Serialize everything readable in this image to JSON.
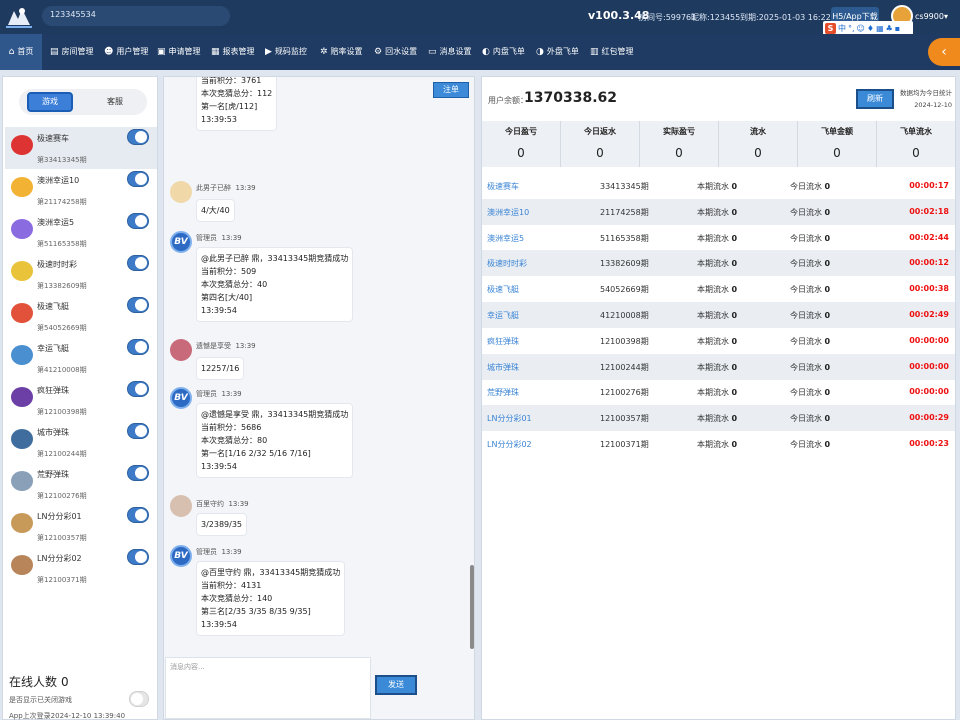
{
  "topbar": {
    "account": "123345534",
    "version": "v100.3.48",
    "room_no": "房间号:599761",
    "nickname": "昵称:123455",
    "expiry": "到期:2025-01-03 16:22:42",
    "h5_label": "H5/App下载",
    "username": "cs9900",
    "ime_label": "S"
  },
  "nav": [
    {
      "label": "首页",
      "icon": "home-icon"
    },
    {
      "label": "房间管理",
      "icon": "room-icon"
    },
    {
      "label": "用户管理",
      "icon": "users-icon"
    },
    {
      "label": "申请管理",
      "icon": "apply-icon"
    },
    {
      "label": "报表管理",
      "icon": "calendar-icon"
    },
    {
      "label": "规码监控",
      "icon": "monitor-icon"
    },
    {
      "label": "赔率设置",
      "icon": "gear-icon"
    },
    {
      "label": "回水设置",
      "icon": "settings-icon"
    },
    {
      "label": "消息设置",
      "icon": "message-icon"
    },
    {
      "label": "内盘飞单",
      "icon": "inner-icon"
    },
    {
      "label": "外盘飞单",
      "icon": "outer-icon"
    },
    {
      "label": "红包管理",
      "icon": "redpacket-icon"
    }
  ],
  "left": {
    "tab_active": "游戏",
    "tab_inactive": "客服",
    "rooms": [
      {
        "name": "极速赛车",
        "period": "第33413345期"
      },
      {
        "name": "澳洲幸运10",
        "period": "第21174258期"
      },
      {
        "name": "澳洲幸运5",
        "period": "第51165358期"
      },
      {
        "name": "极速时时彩",
        "period": "第13382609期"
      },
      {
        "name": "极速飞艇",
        "period": "第54052669期"
      },
      {
        "name": "幸运飞艇",
        "period": "第41210008期"
      },
      {
        "name": "疯狂弹珠",
        "period": "第12100398期"
      },
      {
        "name": "城市弹珠",
        "period": "第12100244期"
      },
      {
        "name": "荒野弹珠",
        "period": "第12100276期"
      },
      {
        "name": "LN分分彩01",
        "period": "第12100357期"
      },
      {
        "name": "LN分分彩02",
        "period": "第12100371期"
      }
    ],
    "online_label": "在线人数",
    "online_count": "0",
    "hide_label": "是否显示已关闭游戏",
    "last_login": "App上次登录2024-12-10 13:39:40"
  },
  "chat": {
    "register_btn": "注单",
    "messages": [
      {
        "lines": [
          "当前积分：3761",
          "本次竞猜总分：112",
          "第一名[虎/112]",
          "13:39:53"
        ]
      },
      {
        "name": "此男子已醉",
        "time": "13:39",
        "lines": [
          "4/大/40"
        ]
      },
      {
        "name": "管理员",
        "time": "13:39",
        "lines": [
          "@此男子已醉 鼎，33413345期竞猜成功",
          "当前积分：509",
          "本次竞猜总分：40",
          "第四名[大/40]",
          "13:39:54"
        ]
      },
      {
        "name": "遗憾是享受",
        "time": "13:39",
        "lines": [
          "12257/16"
        ]
      },
      {
        "name": "管理员",
        "time": "13:39",
        "lines": [
          "@遗憾是享受 鼎，33413345期竞猜成功",
          "当前积分：5686",
          "本次竞猜总分：80",
          "第一名[1/16 2/32 5/16 7/16]",
          "13:39:54"
        ]
      },
      {
        "name": "百里守约",
        "time": "13:39",
        "lines": [
          "3/2389/35"
        ]
      },
      {
        "name": "管理员",
        "time": "13:39",
        "lines": [
          "@百里守约 鼎，33413345期竞猜成功",
          "当前积分：4131",
          "本次竞猜总分：140",
          "第三名[2/35 3/35 8/35 9/35]",
          "13:39:54"
        ]
      }
    ],
    "input_placeholder": "消息内容...",
    "send_btn": "发送"
  },
  "right": {
    "balance_label": "用户余额：",
    "balance": "1370338.62",
    "refresh_btn": "刷新",
    "stat_note_1": "数据均为今日统计",
    "stat_note_2": "2024-12-10",
    "stats": [
      {
        "label": "今日盈亏",
        "value": "0"
      },
      {
        "label": "今日返水",
        "value": "0"
      },
      {
        "label": "实际盈亏",
        "value": "0"
      },
      {
        "label": "流水",
        "value": "0"
      },
      {
        "label": "飞单金额",
        "value": "0"
      },
      {
        "label": "飞单流水",
        "value": "0"
      }
    ],
    "rows": [
      {
        "name": "极速赛车",
        "period": "33413345期",
        "cur_label": "本期流水",
        "cur": "0",
        "day_label": "今日流水",
        "day": "0",
        "timer": "00:00:17"
      },
      {
        "name": "澳洲幸运10",
        "period": "21174258期",
        "cur_label": "本期流水",
        "cur": "0",
        "day_label": "今日流水",
        "day": "0",
        "timer": "00:02:18"
      },
      {
        "name": "澳洲幸运5",
        "period": "51165358期",
        "cur_label": "本期流水",
        "cur": "0",
        "day_label": "今日流水",
        "day": "0",
        "timer": "00:02:44"
      },
      {
        "name": "极速时时彩",
        "period": "13382609期",
        "cur_label": "本期流水",
        "cur": "0",
        "day_label": "今日流水",
        "day": "0",
        "timer": "00:00:12"
      },
      {
        "name": "极速飞艇",
        "period": "54052669期",
        "cur_label": "本期流水",
        "cur": "0",
        "day_label": "今日流水",
        "day": "0",
        "timer": "00:00:38"
      },
      {
        "name": "幸运飞艇",
        "period": "41210008期",
        "cur_label": "本期流水",
        "cur": "0",
        "day_label": "今日流水",
        "day": "0",
        "timer": "00:02:49"
      },
      {
        "name": "疯狂弹珠",
        "period": "12100398期",
        "cur_label": "本期流水",
        "cur": "0",
        "day_label": "今日流水",
        "day": "0",
        "timer": "00:00:00"
      },
      {
        "name": "城市弹珠",
        "period": "12100244期",
        "cur_label": "本期流水",
        "cur": "0",
        "day_label": "今日流水",
        "day": "0",
        "timer": "00:00:00"
      },
      {
        "name": "荒野弹珠",
        "period": "12100276期",
        "cur_label": "本期流水",
        "cur": "0",
        "day_label": "今日流水",
        "day": "0",
        "timer": "00:00:00"
      },
      {
        "name": "LN分分彩01",
        "period": "12100357期",
        "cur_label": "本期流水",
        "cur": "0",
        "day_label": "今日流水",
        "day": "0",
        "timer": "00:00:29"
      },
      {
        "name": "LN分分彩02",
        "period": "12100371期",
        "cur_label": "本期流水",
        "cur": "0",
        "day_label": "今日流水",
        "day": "0",
        "timer": "00:00:23"
      }
    ]
  },
  "colors": {
    "header_bg": "#1e3a5f",
    "accent": "#3c7fd9",
    "timer_red": "#e11111",
    "orange": "#f08a1c"
  }
}
